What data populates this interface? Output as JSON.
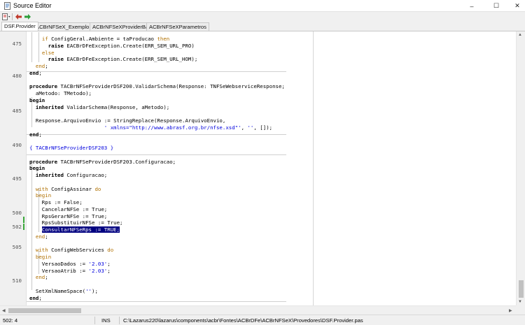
{
  "window": {
    "title": "Source Editor",
    "icon": "document-icon"
  },
  "controls": {
    "minimize": "–",
    "maximize": "☐",
    "close": "✕"
  },
  "tabs": [
    {
      "label": "DSF.Provider",
      "active": true
    },
    {
      "label": "ACBrNFSeX_Exemplo.lpr"
    },
    {
      "label": "ACBrNFSeXProviderBase"
    },
    {
      "label": "ACBrNFSeXParametros"
    }
  ],
  "gutter": [
    "475",
    "480",
    "485",
    "490",
    "495",
    "500",
    "502",
    "505",
    "510"
  ],
  "code": [
    [
      {
        "t": "    "
      },
      {
        "t": "if",
        "c": "kw2"
      },
      {
        "t": " ConfigGeral.Ambiente = taProducao "
      },
      {
        "t": "then",
        "c": "kw2"
      }
    ],
    [
      {
        "t": "      "
      },
      {
        "t": "raise",
        "c": "kw"
      },
      {
        "t": " EACBrDFeException.Create(ERR_SEM_URL_PRO)"
      }
    ],
    [
      {
        "t": "    "
      },
      {
        "t": "else",
        "c": "kw2"
      }
    ],
    [
      {
        "t": "      "
      },
      {
        "t": "raise",
        "c": "kw"
      },
      {
        "t": " EACBrDFeException.Create(ERR_SEM_URL_HOM);"
      }
    ],
    [
      {
        "t": "  "
      },
      {
        "t": "end",
        "c": "kw2"
      },
      {
        "t": ";"
      }
    ],
    [
      {
        "t": "end",
        "c": "kw"
      },
      {
        "t": ";"
      }
    ],
    [
      {
        "t": ""
      }
    ],
    [
      {
        "t": "procedure",
        "c": "kw"
      },
      {
        "t": " TACBrNFSeProviderDSF200.ValidarSchema(Response: TNFSeWebserviceResponse;"
      }
    ],
    [
      {
        "t": "  aMetodo: TMetodo);"
      }
    ],
    [
      {
        "t": "begin",
        "c": "kw"
      }
    ],
    [
      {
        "t": "  "
      },
      {
        "t": "inherited",
        "c": "kw"
      },
      {
        "t": " ValidarSchema(Response, aMetodo);"
      }
    ],
    [
      {
        "t": ""
      }
    ],
    [
      {
        "t": "  Response.ArquivoEnvio := StringReplace(Response.ArquivoEnvio,"
      }
    ],
    [
      {
        "t": "                        "
      },
      {
        "t": "' xmlns=\"http://www.abrasf.org.br/nfse.xsd\"'",
        "c": "str"
      },
      {
        "t": ", "
      },
      {
        "t": "''",
        "c": "str"
      },
      {
        "t": ", []);"
      }
    ],
    [
      {
        "t": "end",
        "c": "kw"
      },
      {
        "t": ";"
      }
    ],
    [
      {
        "t": ""
      }
    ],
    [
      {
        "t": "{ TACBrNFSeProviderDSF203 }",
        "c": "cmt"
      }
    ],
    [
      {
        "t": ""
      }
    ],
    [
      {
        "t": "procedure",
        "c": "kw"
      },
      {
        "t": " TACBrNFSeProviderDSF203.Configuracao;"
      }
    ],
    [
      {
        "t": "begin",
        "c": "kw"
      }
    ],
    [
      {
        "t": "  "
      },
      {
        "t": "inherited",
        "c": "kw"
      },
      {
        "t": " Configuracao;"
      }
    ],
    [
      {
        "t": ""
      }
    ],
    [
      {
        "t": "  "
      },
      {
        "t": "with",
        "c": "kw2"
      },
      {
        "t": " ConfigAssinar "
      },
      {
        "t": "do",
        "c": "kw2"
      }
    ],
    [
      {
        "t": "  "
      },
      {
        "t": "begin",
        "c": "kw2"
      }
    ],
    [
      {
        "t": "    Rps := False;"
      }
    ],
    [
      {
        "t": "    CancelarNFSe := True;"
      }
    ],
    [
      {
        "t": "    RpsGerarNFSe := True;"
      }
    ],
    [
      {
        "t": "    RpsSubstituirNFSe := True;"
      }
    ],
    [
      {
        "t": "    "
      },
      {
        "t": "ConsultarNFSeRps := TRUE;",
        "c": "sel"
      }
    ],
    [
      {
        "t": "  "
      },
      {
        "t": "end",
        "c": "kw2"
      },
      {
        "t": ";"
      }
    ],
    [
      {
        "t": ""
      }
    ],
    [
      {
        "t": "  "
      },
      {
        "t": "with",
        "c": "kw2"
      },
      {
        "t": " ConfigWebServices "
      },
      {
        "t": "do",
        "c": "kw2"
      }
    ],
    [
      {
        "t": "  "
      },
      {
        "t": "begin",
        "c": "kw2"
      }
    ],
    [
      {
        "t": "    VersaoDados := "
      },
      {
        "t": "'2.03'",
        "c": "str"
      },
      {
        "t": ";"
      }
    ],
    [
      {
        "t": "    VersaoAtrib := "
      },
      {
        "t": "'2.03'",
        "c": "str"
      },
      {
        "t": ";"
      }
    ],
    [
      {
        "t": "  "
      },
      {
        "t": "end",
        "c": "kw2"
      },
      {
        "t": ";"
      }
    ],
    [
      {
        "t": ""
      }
    ],
    [
      {
        "t": "  SetXmlNameSpace("
      },
      {
        "t": "''",
        "c": "str"
      },
      {
        "t": ");"
      }
    ],
    [
      {
        "t": "end",
        "c": "kw"
      },
      {
        "t": ";"
      }
    ]
  ],
  "status": {
    "position": "502: 4",
    "mode": "INS",
    "file": "C:\\Lazarus220\\lazarus\\components\\acbr\\Fontes\\ACBrDFe\\ACBrNFSeX\\Provedores\\DSF.Provider.pas"
  }
}
